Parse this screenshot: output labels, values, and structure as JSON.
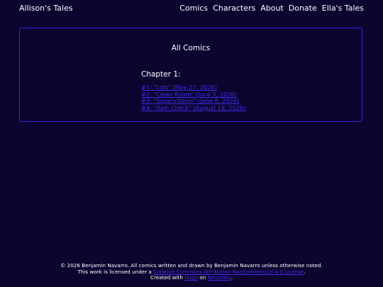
{
  "site": {
    "title": "Allison's Tales"
  },
  "nav": {
    "items": [
      "Comics",
      "Characters",
      "About",
      "Donate",
      "Ella's Tales"
    ]
  },
  "main": {
    "title": "All Comics",
    "chapters": [
      {
        "heading": "Chapter 1:",
        "entries": [
          "#1: \"Lots\" (May 27, 2026)",
          "#2: \"Clean Room\" (June 3, 2026)",
          "#3: \"Supervillains\" (June 8, 2026)",
          "#4: \"Rain Check\" (August 18, 2026)"
        ]
      }
    ]
  },
  "footer": {
    "line1": "© 2026 Benjamin Navarro. All comics written and drawn by Benjamin Navarro unless otherwise noted.",
    "line2_prefix": "This work is licensed under a ",
    "license_link": "Creative Commons Attribution-NonCommercial 4.0 License",
    "line2_suffix": ".",
    "line3_prefix": "Created with ",
    "tool_link": "Hugo",
    "line3_middle": " on ",
    "host_link": "Neocities",
    "line3_suffix": "."
  }
}
